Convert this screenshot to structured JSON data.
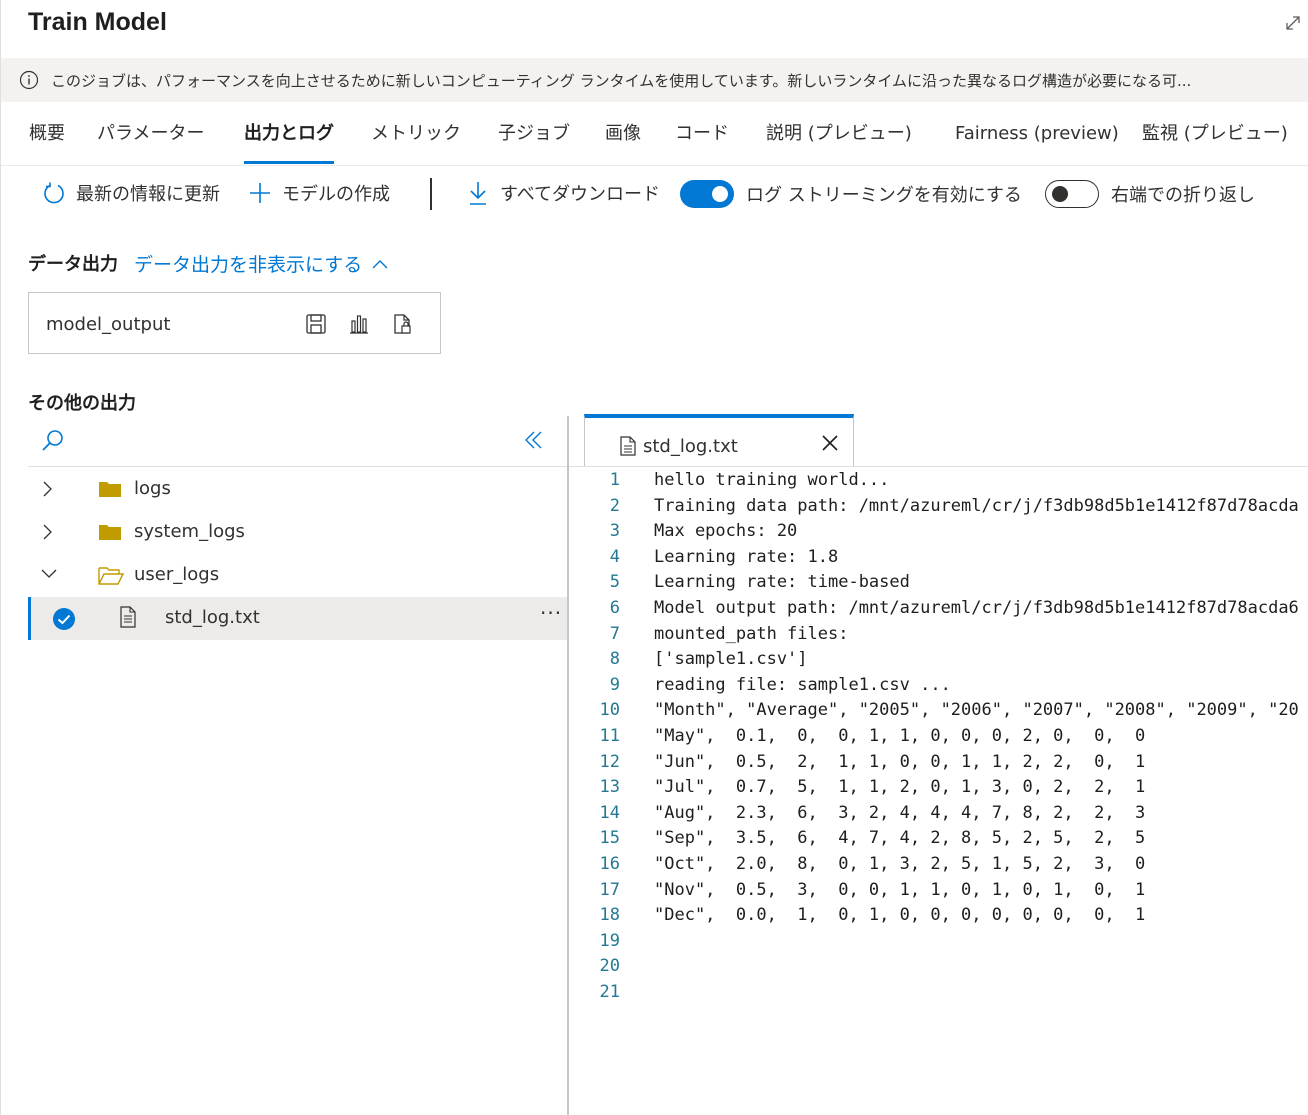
{
  "header": {
    "title": "Train Model"
  },
  "banner": {
    "text": "このジョブは、パフォーマンスを向上させるために新しいコンピューティング ランタイムを使用しています。新しいランタイムに沿った異なるログ構造が必要になる可..."
  },
  "tabs": [
    {
      "label": "概要"
    },
    {
      "label": "パラメーター"
    },
    {
      "label": "出力とログ"
    },
    {
      "label": "メトリック"
    },
    {
      "label": "子ジョブ"
    },
    {
      "label": "画像"
    },
    {
      "label": "コード"
    },
    {
      "label": "説明 (プレビュー)"
    },
    {
      "label": "Fairness (preview)"
    },
    {
      "label": "監視 (プレビュー)"
    }
  ],
  "toolbar": {
    "refresh": "最新の情報に更新",
    "create_model": "モデルの作成",
    "download_all": "すべてダウンロード",
    "log_streaming": "ログ ストリーミングを有効にする",
    "log_streaming_on": true,
    "wrap": "右端での折り返し",
    "wrap_on": false
  },
  "data_output": {
    "label": "データ出力",
    "hide_link": "データ出力を非表示にする",
    "item_name": "model_output"
  },
  "other_output": {
    "label": "その他の出力"
  },
  "tree": [
    {
      "label": "logs",
      "expanded": false
    },
    {
      "label": "system_logs",
      "expanded": false
    },
    {
      "label": "user_logs",
      "expanded": true
    },
    {
      "label": "std_log.txt",
      "selected": true
    }
  ],
  "editor": {
    "tab_label": "std_log.txt",
    "lines": [
      {
        "n": "1",
        "t": "hello training world..."
      },
      {
        "n": "2",
        "t": "Training data path: /mnt/azureml/cr/j/f3db98d5b1e1412f87d78acda"
      },
      {
        "n": "3",
        "t": "Max epochs: 20"
      },
      {
        "n": "4",
        "t": "Learning rate: 1.8"
      },
      {
        "n": "5",
        "t": "Learning rate: time-based"
      },
      {
        "n": "6",
        "t": "Model output path: /mnt/azureml/cr/j/f3db98d5b1e1412f87d78acda6"
      },
      {
        "n": "7",
        "t": "mounted_path files:"
      },
      {
        "n": "8",
        "t": "['sample1.csv']"
      },
      {
        "n": "9",
        "t": "reading file: sample1.csv ..."
      },
      {
        "n": "10",
        "t": "\"Month\", \"Average\", \"2005\", \"2006\", \"2007\", \"2008\", \"2009\", \"20"
      },
      {
        "n": "11",
        "t": "\"May\",  0.1,  0,  0, 1, 1, 0, 0, 0, 2, 0,  0,  0"
      },
      {
        "n": "12",
        "t": "\"Jun\",  0.5,  2,  1, 1, 0, 0, 1, 1, 2, 2,  0,  1"
      },
      {
        "n": "13",
        "t": "\"Jul\",  0.7,  5,  1, 1, 2, 0, 1, 3, 0, 2,  2,  1"
      },
      {
        "n": "14",
        "t": "\"Aug\",  2.3,  6,  3, 2, 4, 4, 4, 7, 8, 2,  2,  3"
      },
      {
        "n": "15",
        "t": "\"Sep\",  3.5,  6,  4, 7, 4, 2, 8, 5, 2, 5,  2,  5"
      },
      {
        "n": "16",
        "t": "\"Oct\",  2.0,  8,  0, 1, 3, 2, 5, 1, 5, 2,  3,  0"
      },
      {
        "n": "17",
        "t": "\"Nov\",  0.5,  3,  0, 0, 1, 1, 0, 1, 0, 1,  0,  1"
      },
      {
        "n": "18",
        "t": "\"Dec\",  0.0,  1,  0, 1, 0, 0, 0, 0, 0, 0,  0,  1"
      },
      {
        "n": "19",
        "t": ""
      },
      {
        "n": "20",
        "t": ""
      },
      {
        "n": "21",
        "t": ""
      }
    ]
  },
  "colors": {
    "accent": "#0078d4",
    "folder": "#c19c00",
    "line_number": "#237893"
  }
}
